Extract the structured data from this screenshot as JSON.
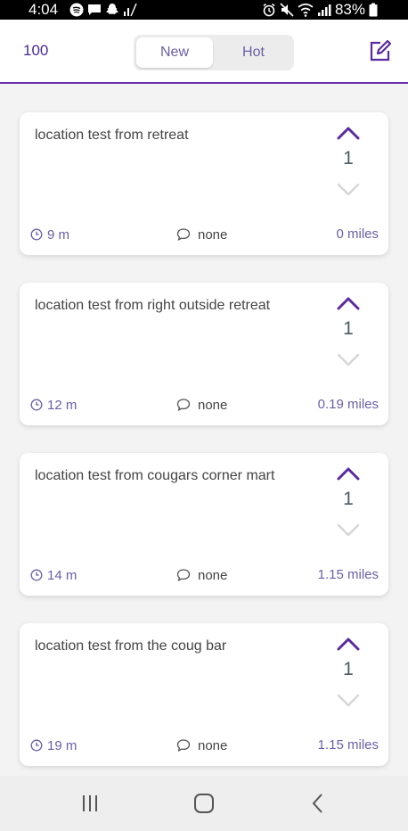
{
  "status_bar": {
    "time": "4:04",
    "battery": "83%",
    "icons": [
      "spotify-icon",
      "message-icon",
      "snapchat-icon",
      "signal-icon",
      "alarm-icon",
      "mute-icon",
      "wifi-icon",
      "cell-signal-icon",
      "battery-icon"
    ]
  },
  "header": {
    "karma": "100",
    "tabs": [
      {
        "label": "New",
        "selected": true
      },
      {
        "label": "Hot",
        "selected": false
      }
    ],
    "compose_icon": "compose-icon"
  },
  "posts": [
    {
      "text": "location test from retreat",
      "votes": "1",
      "age": "9 m",
      "comments": "none",
      "distance": "0 miles"
    },
    {
      "text": "location test from right outside retreat",
      "votes": "1",
      "age": "12 m",
      "comments": "none",
      "distance": "0.19 miles"
    },
    {
      "text": "location test from cougars corner mart",
      "votes": "1",
      "age": "14 m",
      "comments": "none",
      "distance": "1.15 miles"
    },
    {
      "text": "location test from the coug bar",
      "votes": "1",
      "age": "19 m",
      "comments": "none",
      "distance": "1.15 miles"
    }
  ],
  "nav_bar": {
    "buttons": [
      "recents-icon",
      "home-icon",
      "back-icon"
    ]
  },
  "colors": {
    "accent": "#6a2fa8",
    "accent_text": "#6a5fa8",
    "vote_arrow_inactive": "#d6d6d6",
    "background": "#f3f3f3"
  }
}
